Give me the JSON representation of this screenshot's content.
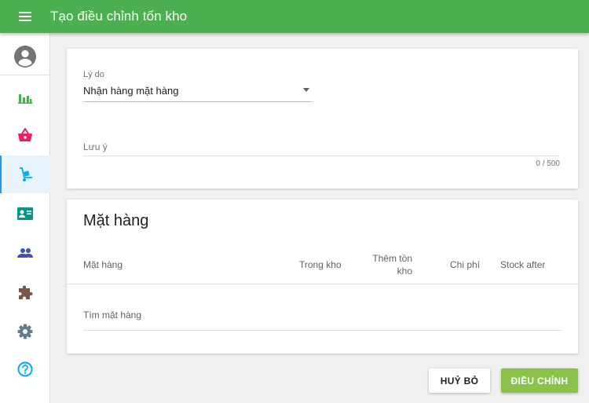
{
  "appbar": {
    "title": "Tạo điều chỉnh tốn kho",
    "menu_icon": "hamburger-menu-icon"
  },
  "sidebar": {
    "items": [
      {
        "icon": "account-circle-icon",
        "color": "#757575",
        "active": false
      },
      {
        "icon": "bar-chart-icon",
        "color": "#4caf50",
        "active": false
      },
      {
        "icon": "shopping-basket-icon",
        "color": "#e91e63",
        "active": false
      },
      {
        "icon": "hand-truck-icon",
        "color": "#03a9f4",
        "active": true
      },
      {
        "icon": "contact-card-icon",
        "color": "#009688",
        "active": false
      },
      {
        "icon": "people-icon",
        "color": "#3f51b5",
        "active": false
      },
      {
        "icon": "extension-puzzle-icon",
        "color": "#795548",
        "active": false
      },
      {
        "icon": "settings-gear-icon",
        "color": "#607d8b",
        "active": false
      },
      {
        "icon": "help-circle-icon",
        "color": "#03a9f4",
        "active": false
      }
    ]
  },
  "form": {
    "reason_label": "Lý do",
    "reason_value": "Nhận hàng mặt hàng",
    "note_placeholder": "Lưu ý",
    "note_counter": "0 / 500"
  },
  "items_section": {
    "title": "Mặt hàng",
    "columns": {
      "item": "Mặt hàng",
      "in_stock": "Trong kho",
      "add_line1": "Thêm tồn",
      "add_line2": "kho",
      "cost": "Chi phí",
      "stock_after": "Stock after"
    },
    "search_placeholder": "Tìm mặt hàng"
  },
  "actions": {
    "cancel": "HUỶ BỎ",
    "adjust": "ĐIỀU CHỈNH"
  },
  "colors": {
    "appbar": "#4caf50",
    "primary_button": "#8bc34a",
    "active_accent": "#2196f3"
  }
}
